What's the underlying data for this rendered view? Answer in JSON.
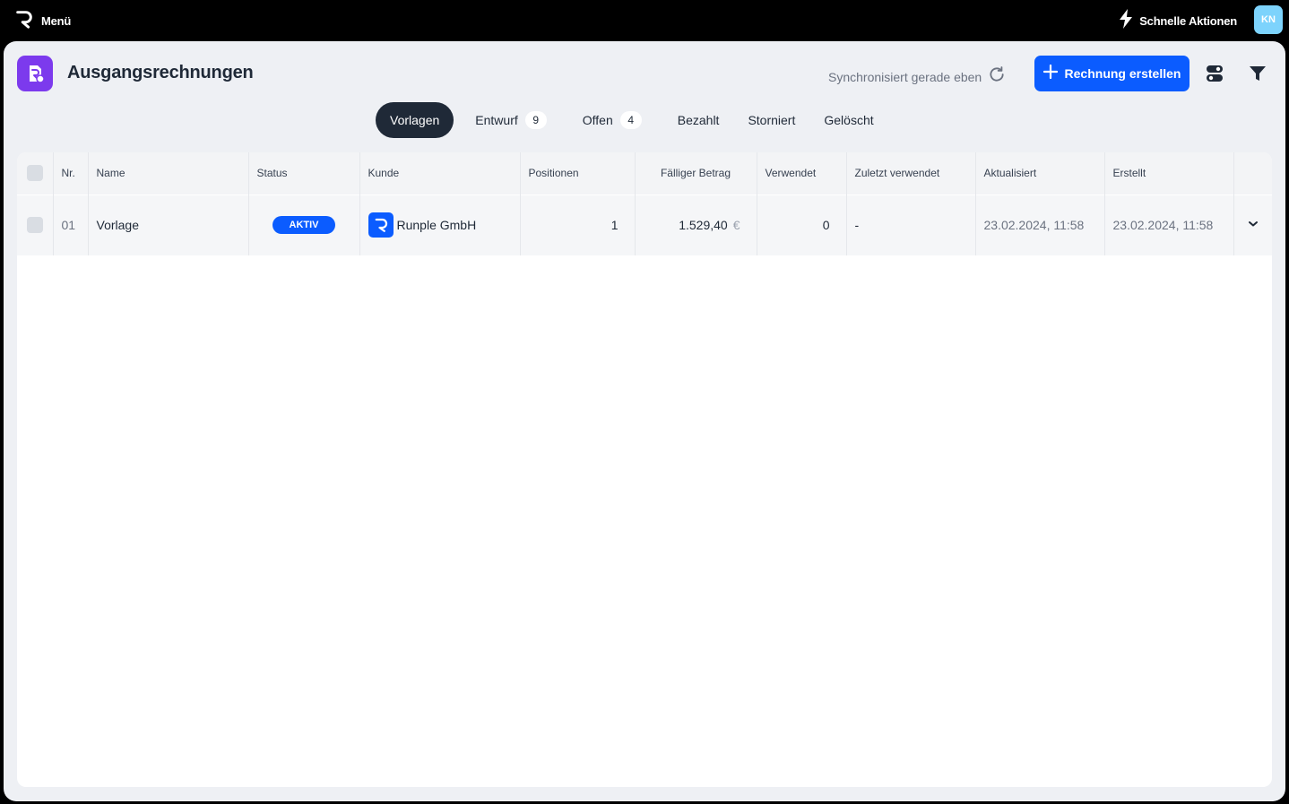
{
  "topbar": {
    "menu_label": "Menü",
    "quick_actions_label": "Schnelle Aktionen",
    "avatar_initials": "KN"
  },
  "header": {
    "title": "Ausgangsrechnungen",
    "sync_status": "Synchronisiert gerade eben",
    "create_button": "Rechnung erstellen"
  },
  "tabs": [
    {
      "label": "Vorlagen",
      "count": null,
      "active": true
    },
    {
      "label": "Entwurf",
      "count": "9",
      "active": false
    },
    {
      "label": "Offen",
      "count": "4",
      "active": false
    },
    {
      "label": "Bezahlt",
      "count": null,
      "active": false
    },
    {
      "label": "Storniert",
      "count": null,
      "active": false
    },
    {
      "label": "Gelöscht",
      "count": null,
      "active": false
    }
  ],
  "table": {
    "columns": [
      "Nr.",
      "Name",
      "Status",
      "Kunde",
      "Positionen",
      "Fälliger Betrag",
      "Verwendet",
      "Zuletzt verwendet",
      "Aktualisiert",
      "Erstellt"
    ],
    "rows": [
      {
        "nr": "01",
        "name": "Vorlage",
        "status": "AKTIV",
        "customer": "Runple GmbH",
        "positions": "1",
        "amount": "1.529,40",
        "currency": "€",
        "used": "0",
        "last_used": "-",
        "updated": "23.02.2024, 11:58",
        "created": "23.02.2024, 11:58"
      }
    ]
  },
  "colors": {
    "accent": "#0b5cff",
    "app_icon": "#7c3aed",
    "active_tab": "#1f2937",
    "avatar": "#7dd3fc"
  },
  "icons": {
    "brand": "runple-logo-icon",
    "quick_actions": "lightning-icon",
    "app": "invoice-icon",
    "sync": "refresh-icon",
    "create": "plus-icon",
    "toggle": "toggle-icon",
    "filter": "filter-icon",
    "row_expand": "chevron-down-icon"
  }
}
